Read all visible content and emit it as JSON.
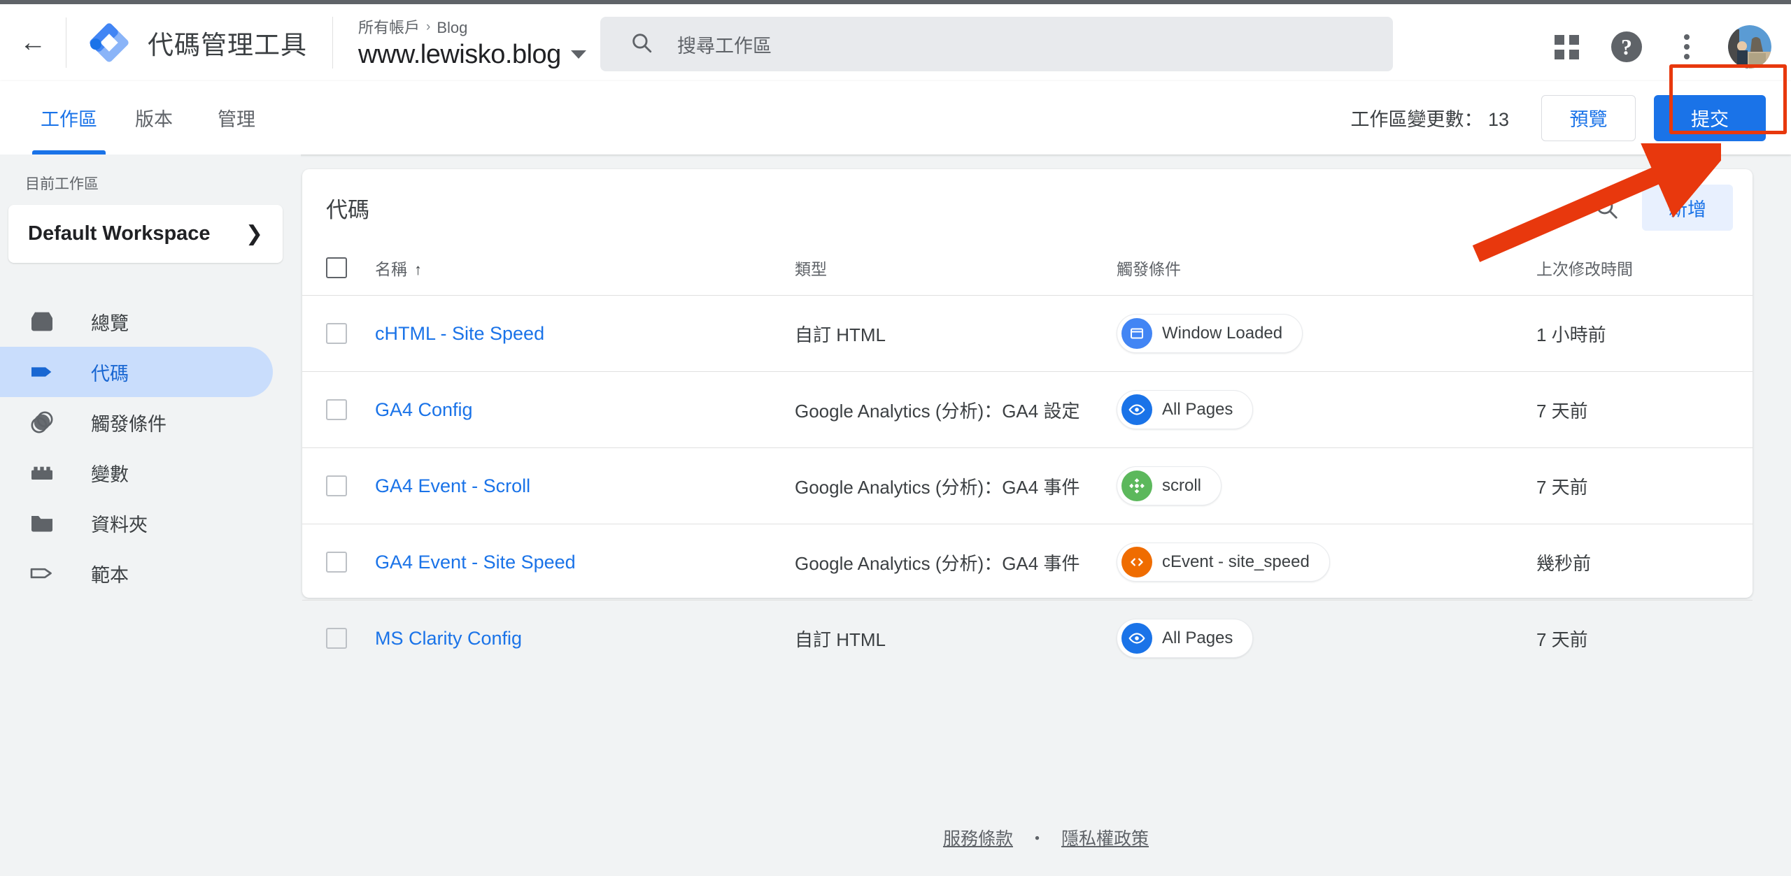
{
  "header": {
    "back_icon": "arrow-left-icon",
    "logo_icon": "google-tag-manager-logo",
    "product_title": "代碼管理工具",
    "breadcrumb": {
      "account": "所有帳戶",
      "separator": "›",
      "container": "Blog"
    },
    "container_name": "www.lewisko.blog",
    "container_caret": "caret-down-icon",
    "search": {
      "icon": "search-icon",
      "placeholder": "搜尋工作區",
      "value": ""
    },
    "right_icons": [
      "apps-grid-icon",
      "help-circle-icon",
      "more-vertical-icon",
      "user-avatar"
    ]
  },
  "navbar": {
    "tabs": [
      {
        "label": "工作區",
        "active": true
      },
      {
        "label": "版本",
        "active": false
      },
      {
        "label": "管理",
        "active": false
      }
    ],
    "changes_label": "工作區變更數：",
    "changes_count": "13",
    "changes_text": "工作區變更數： 13",
    "preview_label": "預覽",
    "submit_label": "提交"
  },
  "sidebar": {
    "current_workspace_label": "目前工作區",
    "workspace_name": "Default Workspace",
    "workspace_chevron": "chevron-right-icon",
    "items": [
      {
        "label": "總覽",
        "icon": "overview-box-icon",
        "active": false
      },
      {
        "label": "代碼",
        "icon": "tag-filled-icon",
        "active": true
      },
      {
        "label": "觸發條件",
        "icon": "triggers-circles-icon",
        "active": false
      },
      {
        "label": "變數",
        "icon": "variables-brick-icon",
        "active": false
      },
      {
        "label": "資料夾",
        "icon": "folder-icon",
        "active": false
      },
      {
        "label": "範本",
        "icon": "template-tag-outline-icon",
        "active": false
      }
    ]
  },
  "main": {
    "card_title": "代碼",
    "search_icon": "search-icon",
    "new_button_label": "新增",
    "columns": [
      "名稱",
      "類型",
      "觸發條件",
      "上次修改時間"
    ],
    "sort_indicator": "↑",
    "rows": [
      {
        "name": "cHTML - Site Speed",
        "type": "自訂 HTML",
        "trigger": {
          "label": "Window Loaded",
          "icon": "window-icon",
          "color": "#4285f4"
        },
        "modified": "1 小時前"
      },
      {
        "name": "GA4 Config",
        "type": "Google Analytics (分析)：GA4 設定",
        "trigger": {
          "label": "All Pages",
          "icon": "eye-icon",
          "color": "#1a73e8"
        },
        "modified": "7 天前"
      },
      {
        "name": "GA4 Event - Scroll",
        "type": "Google Analytics (分析)：GA4 事件",
        "trigger": {
          "label": "scroll",
          "icon": "scroll-move-icon",
          "color": "#5cb85c"
        },
        "modified": "7 天前"
      },
      {
        "name": "GA4 Event - Site Speed",
        "type": "Google Analytics (分析)：GA4 事件",
        "trigger": {
          "label": "cEvent - site_speed",
          "icon": "code-brackets-icon",
          "color": "#ef6c00"
        },
        "modified": "幾秒前"
      },
      {
        "name": "MS Clarity Config",
        "type": "自訂 HTML",
        "trigger": {
          "label": "All Pages",
          "icon": "eye-icon",
          "color": "#1a73e8"
        },
        "modified": "7 天前"
      }
    ]
  },
  "footer": {
    "terms": "服務條款",
    "dot": "・",
    "privacy": "隱私權政策"
  },
  "annotations": {
    "highlight_color": "#e8380d",
    "highlight_target": "提交",
    "arrow": "red-arrow-pointing-to-submit"
  },
  "colors": {
    "accent_blue": "#1a73e8",
    "page_bg": "#f1f3f4",
    "active_nav_bg": "#c9ddfc",
    "annotation_red": "#e8380d"
  }
}
